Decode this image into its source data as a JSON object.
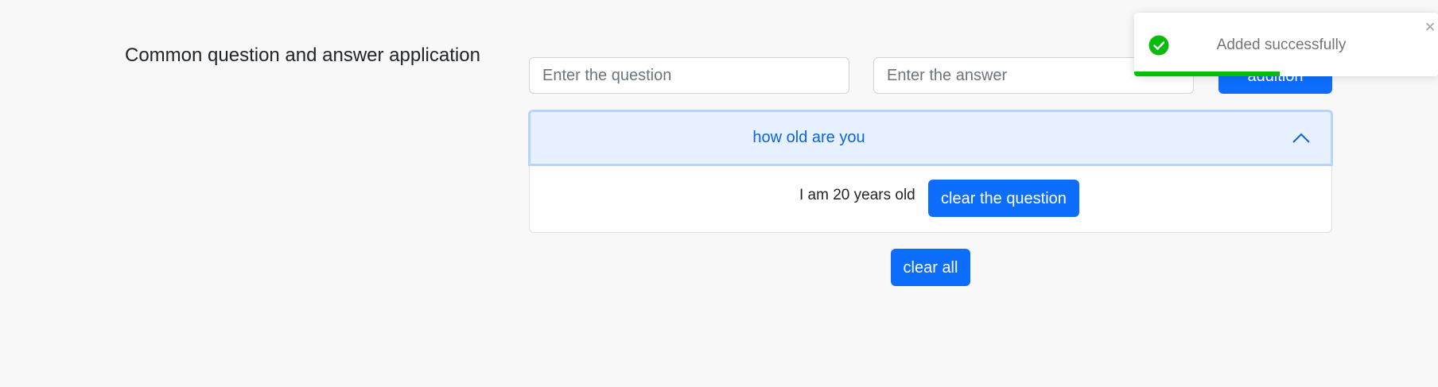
{
  "app": {
    "title": "Common question and answer application"
  },
  "form": {
    "question_placeholder": "Enter the question",
    "answer_placeholder": "Enter the answer",
    "question_value": "",
    "answer_value": "",
    "add_button_label": "addition"
  },
  "qa_list": [
    {
      "question": "how old are you",
      "answer": "I am 20 years old",
      "expanded": true,
      "clear_button_label": "clear the question"
    }
  ],
  "actions": {
    "clear_all_label": "clear all"
  },
  "toast": {
    "message": "Added successfully",
    "close_glyph": "×",
    "progress": 0.48,
    "icon": "check-circle-icon"
  },
  "colors": {
    "primary": "#0d6efd",
    "accordion_active_bg": "#e7f1ff",
    "accordion_active_text": "#0c63e4",
    "toast_success": "#07bc0c",
    "page_bg": "#f8f8f8"
  }
}
